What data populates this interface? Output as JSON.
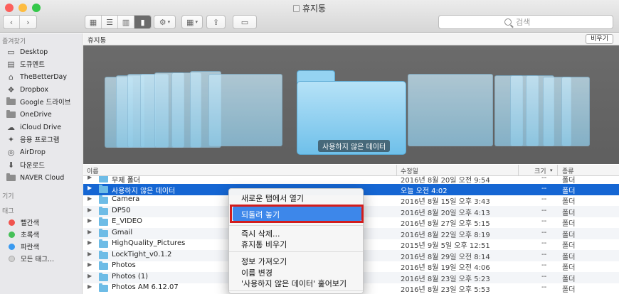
{
  "window": {
    "title": "휴지통",
    "traffic_colors": [
      "#fc605c",
      "#fdbc40",
      "#34c84a"
    ]
  },
  "toolbar": {
    "back_icon": "chevron-left-icon",
    "forward_icon": "chevron-right-icon",
    "view_icons": [
      "icon-view-icon",
      "list-view-icon",
      "column-view-icon",
      "coverflow-view-icon"
    ],
    "search_placeholder": "검색"
  },
  "sidebar": {
    "favorites_header": "즐겨찾기",
    "favorites": [
      {
        "label": "Desktop",
        "icon": "desktop-icon"
      },
      {
        "label": "도큐멘트",
        "icon": "document-icon"
      },
      {
        "label": "TheBetterDay",
        "icon": "home-icon"
      },
      {
        "label": "Dropbox",
        "icon": "dropbox-icon"
      },
      {
        "label": "Google 드라이브",
        "icon": "folder-icon"
      },
      {
        "label": "OneDrive",
        "icon": "folder-icon"
      },
      {
        "label": "iCloud Drive",
        "icon": "cloud-icon"
      },
      {
        "label": "응용 프로그램",
        "icon": "applications-icon"
      },
      {
        "label": "AirDrop",
        "icon": "airdrop-icon"
      },
      {
        "label": "다운로드",
        "icon": "download-icon"
      },
      {
        "label": "NAVER Cloud",
        "icon": "folder-icon"
      }
    ],
    "devices_header": "기기",
    "tags_header": "태그",
    "tags": [
      {
        "label": "빨간색",
        "color": "#f0544f"
      },
      {
        "label": "초록색",
        "color": "#46c058"
      },
      {
        "label": "파란색",
        "color": "#3a9af0"
      },
      {
        "label": "모든 태그...",
        "color": "#d0d0d0"
      }
    ]
  },
  "pathbar": {
    "name": "휴지통",
    "empty_button": "비우기"
  },
  "coverflow": {
    "caption": "사용하지 않은 데이터"
  },
  "list": {
    "headers": {
      "name": "이름",
      "date": "수정일",
      "size": "크기",
      "kind": "종류"
    },
    "rows": [
      {
        "name": "무제 폴더",
        "date": "2016년 8월 20일 오전 9:54",
        "size": "--",
        "kind": "폴더"
      },
      {
        "name": "사용하지 않은 데이터",
        "date": "오늘 오전 4:02",
        "size": "--",
        "kind": "폴더"
      },
      {
        "name": "Camera",
        "date": "2016년 8월 15일 오후 3:43",
        "size": "--",
        "kind": "폴더"
      },
      {
        "name": "DP50",
        "date": "2016년 8월 20일 오후 4:13",
        "size": "--",
        "kind": "폴더"
      },
      {
        "name": "E_VIDEO",
        "date": "2016년 8월 27일 오후 5:15",
        "size": "--",
        "kind": "폴더"
      },
      {
        "name": "Gmail",
        "date": "2016년 8월 22일 오후 8:19",
        "size": "--",
        "kind": "폴더"
      },
      {
        "name": "HighQuality_Pictures",
        "date": "2015년 9월 5일 오후 12:51",
        "size": "--",
        "kind": "폴더"
      },
      {
        "name": "LockTight_v0.1.2",
        "date": "2016년 8월 29일 오전 8:14",
        "size": "--",
        "kind": "폴더"
      },
      {
        "name": "Photos",
        "date": "2016년 8월 19일 오전 4:06",
        "size": "--",
        "kind": "폴더"
      },
      {
        "name": "Photos (1)",
        "date": "2016년 8월 23일 오후 5:23",
        "size": "--",
        "kind": "폴더"
      },
      {
        "name": "Photos AM 6.12.07",
        "date": "2016년 8월 23일 오후 5:53",
        "size": "--",
        "kind": "폴더"
      }
    ]
  },
  "context_menu": {
    "items": [
      "새로운 탭에서 열기",
      "되돌려 놓기",
      "즉시 삭제...",
      "휴지통 비우기",
      "정보 가져오기",
      "이름 변경",
      "'사용하지 않은 데이터' 훑어보기"
    ],
    "highlight_color": "#3d87ea",
    "annotation_color": "#d21d1d"
  }
}
